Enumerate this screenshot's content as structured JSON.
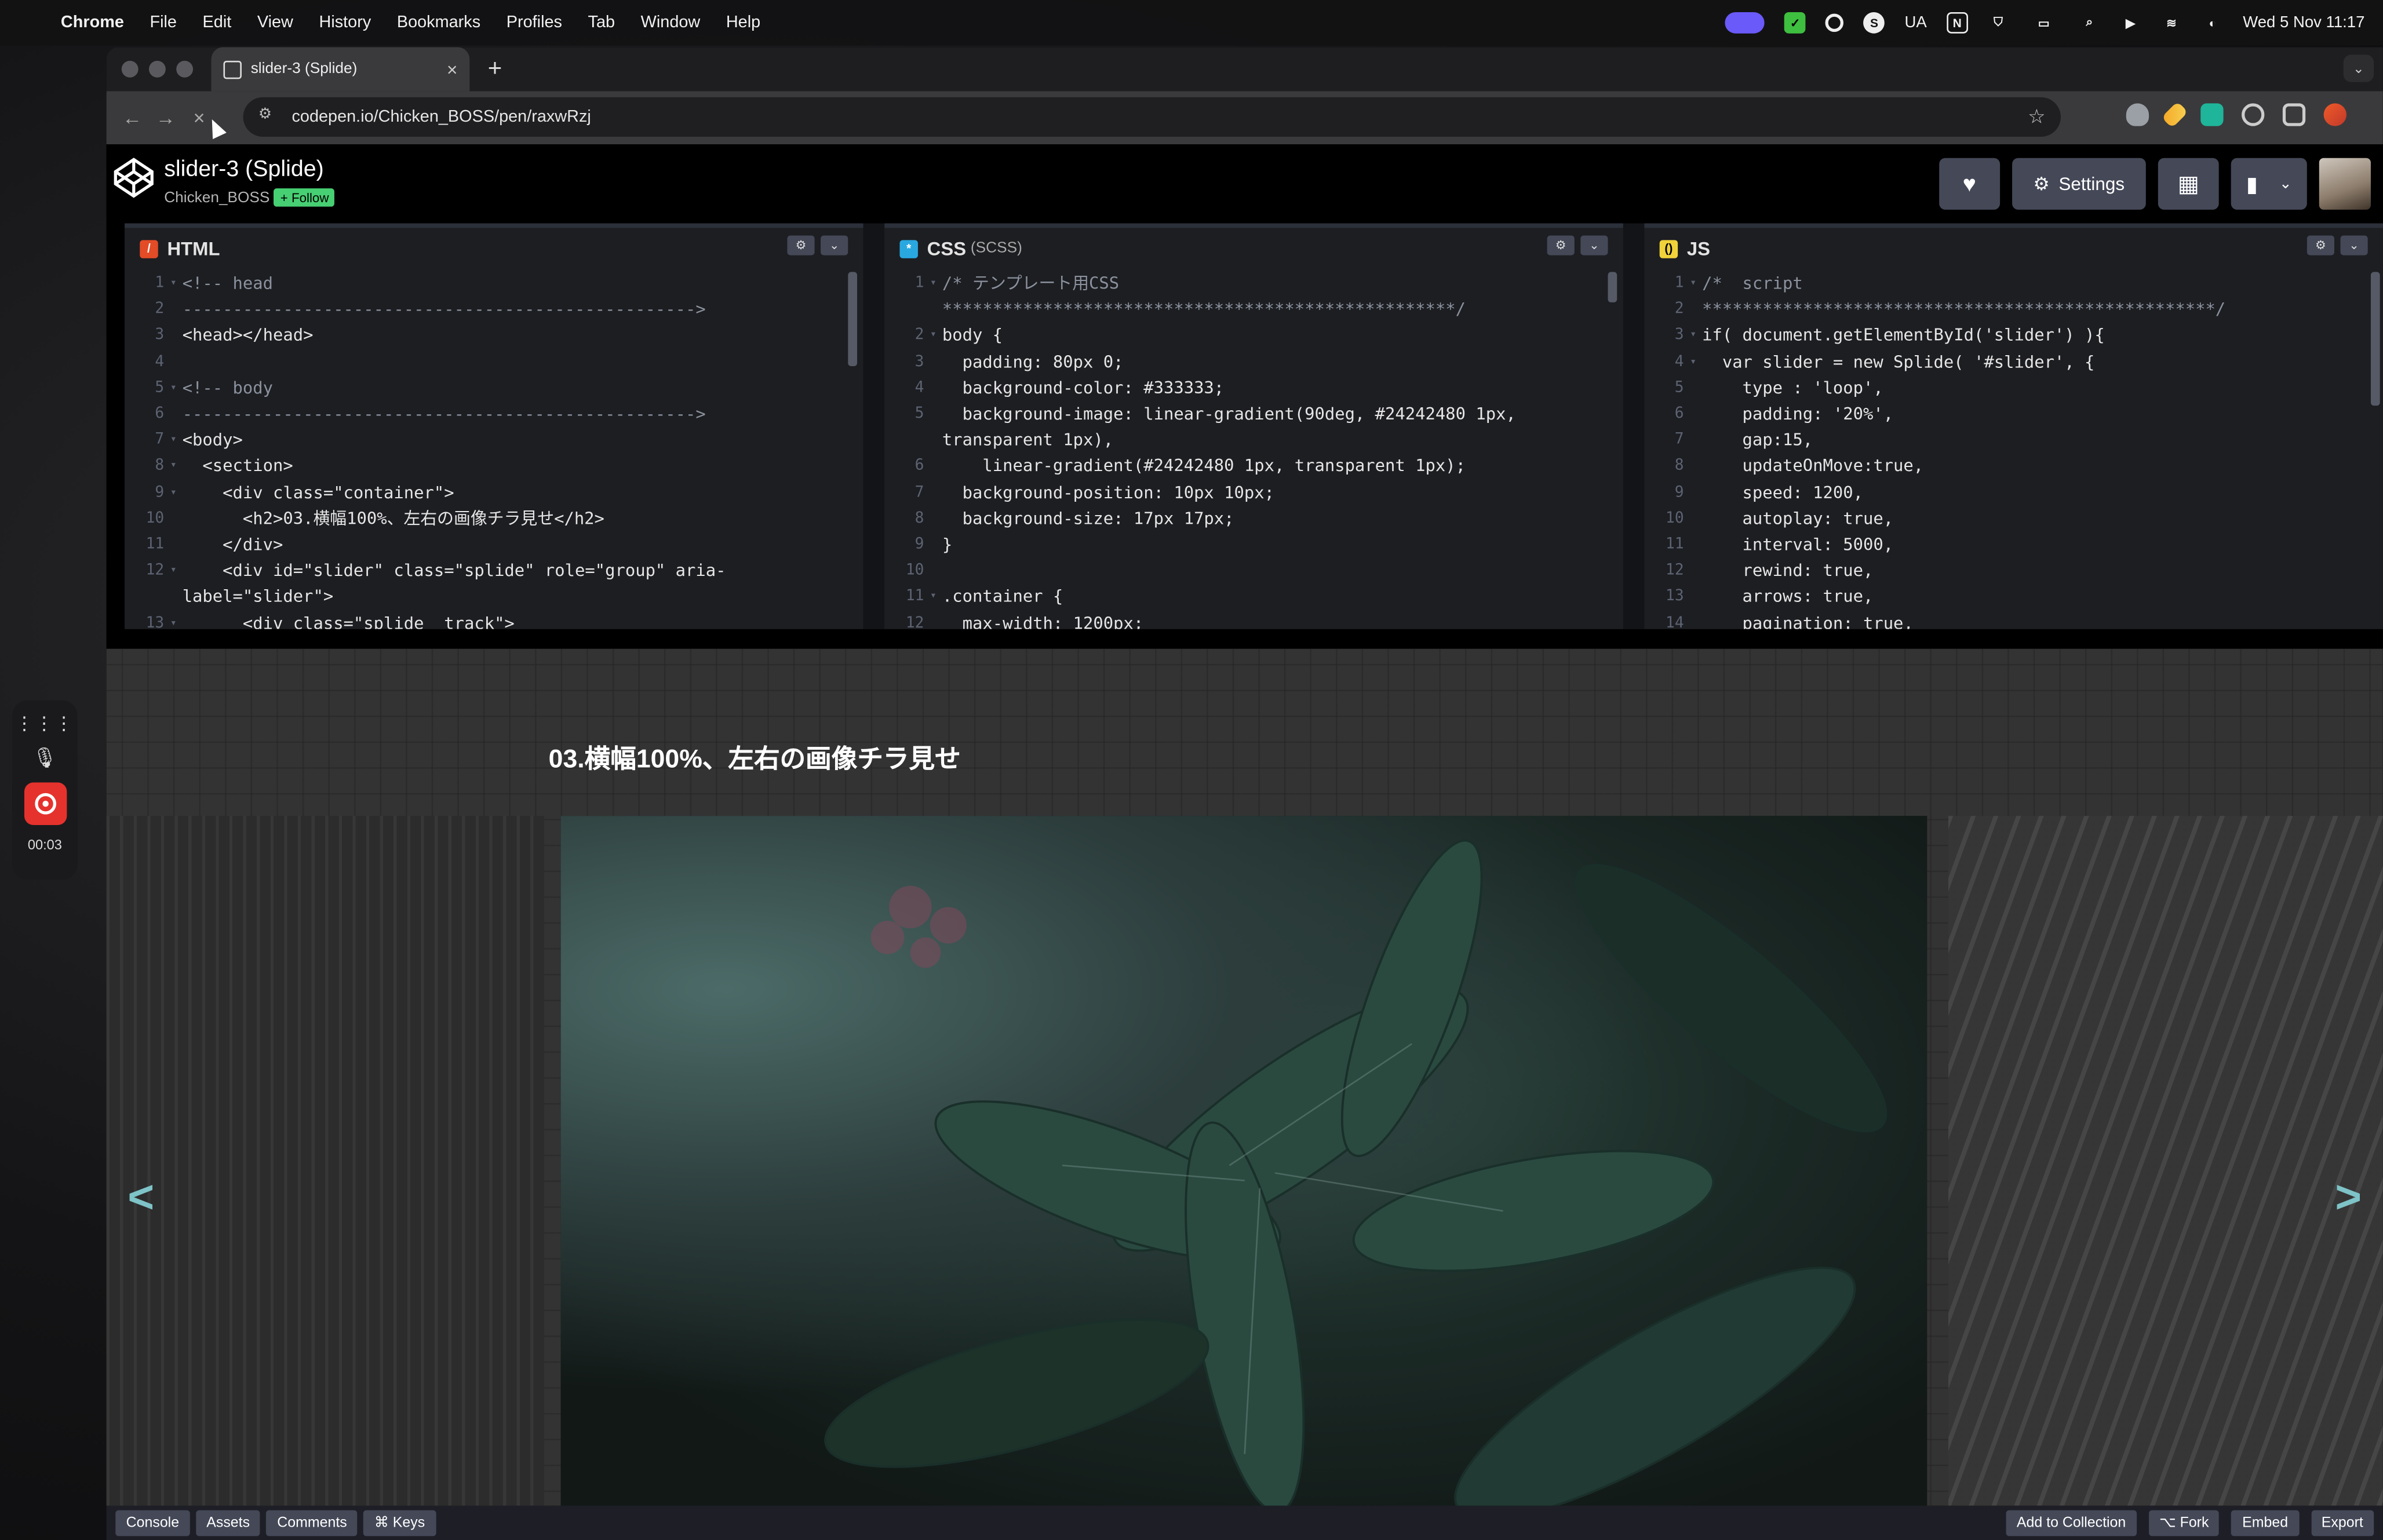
{
  "menubar": {
    "app": "Chrome",
    "items": [
      "File",
      "Edit",
      "View",
      "History",
      "Bookmarks",
      "Profiles",
      "Tab",
      "Window",
      "Help"
    ],
    "status_text": "UA",
    "datetime": "Wed 5 Nov  11:17"
  },
  "browser": {
    "tab_title": "slider-3 (Splide)",
    "url": "codepen.io/Chicken_BOSS/pen/raxwRzj"
  },
  "codepen": {
    "pen_title": "slider-3 (Splide)",
    "author": "Chicken_BOSS",
    "follow_label": "+ Follow",
    "settings_label": "Settings"
  },
  "editors": {
    "html": {
      "label": "HTML",
      "lines": [
        {
          "n": "1",
          "fold": "▾",
          "t": "<!-- head"
        },
        {
          "n": "2",
          "fold": "",
          "t": "--------------------------------------------------->"
        },
        {
          "n": "3",
          "fold": "",
          "t": "<head></head>"
        },
        {
          "n": "4",
          "fold": "",
          "t": ""
        },
        {
          "n": "5",
          "fold": "▾",
          "t": "<!-- body"
        },
        {
          "n": "6",
          "fold": "",
          "t": "--------------------------------------------------->"
        },
        {
          "n": "7",
          "fold": "▾",
          "t": "<body>"
        },
        {
          "n": "8",
          "fold": "▾",
          "t": "  <section>"
        },
        {
          "n": "9",
          "fold": "▾",
          "t": "    <div class=\"container\">"
        },
        {
          "n": "10",
          "fold": "",
          "t": "      <h2>03.横幅100%、左右の画像チラ見せ</h2>"
        },
        {
          "n": "11",
          "fold": "",
          "t": "    </div>"
        },
        {
          "n": "12",
          "fold": "▾",
          "t": "    <div id=\"slider\" class=\"splide\" role=\"group\" aria-"
        },
        {
          "n": "",
          "fold": "",
          "t": "label=\"slider\">"
        },
        {
          "n": "13",
          "fold": "▾",
          "t": "      <div class=\"splide__track\">"
        }
      ]
    },
    "css": {
      "label": "CSS",
      "sublabel": "(SCSS)",
      "lines": [
        {
          "n": "1",
          "fold": "▾",
          "t": "/* テンプレート用CSS"
        },
        {
          "n": "",
          "fold": "",
          "t": "***************************************************/"
        },
        {
          "n": "2",
          "fold": "▾",
          "t": "body {"
        },
        {
          "n": "3",
          "fold": "",
          "t": "  padding: 80px 0;"
        },
        {
          "n": "4",
          "fold": "",
          "t": "  background-color: #333333;"
        },
        {
          "n": "5",
          "fold": "",
          "t": "  background-image: linear-gradient(90deg, #24242480 1px,"
        },
        {
          "n": "",
          "fold": "",
          "t": "transparent 1px),"
        },
        {
          "n": "6",
          "fold": "",
          "t": "    linear-gradient(#24242480 1px, transparent 1px);"
        },
        {
          "n": "7",
          "fold": "",
          "t": "  background-position: 10px 10px;"
        },
        {
          "n": "8",
          "fold": "",
          "t": "  background-size: 17px 17px;"
        },
        {
          "n": "9",
          "fold": "",
          "t": "}"
        },
        {
          "n": "10",
          "fold": "",
          "t": ""
        },
        {
          "n": "11",
          "fold": "▾",
          "t": ".container {"
        },
        {
          "n": "12",
          "fold": "",
          "t": "  max-width: 1200px;"
        }
      ]
    },
    "js": {
      "label": "JS",
      "lines": [
        {
          "n": "1",
          "fold": "▾",
          "t": "/*  script"
        },
        {
          "n": "2",
          "fold": "",
          "t": "***************************************************/"
        },
        {
          "n": "3",
          "fold": "▾",
          "t": "if( document.getElementById('slider') ){"
        },
        {
          "n": "4",
          "fold": "▾",
          "t": "  var slider = new Splide( '#slider', {"
        },
        {
          "n": "5",
          "fold": "",
          "t": "    type : 'loop',"
        },
        {
          "n": "6",
          "fold": "",
          "t": "    padding: '20%',"
        },
        {
          "n": "7",
          "fold": "",
          "t": "    gap:15,"
        },
        {
          "n": "8",
          "fold": "",
          "t": "    updateOnMove:true,"
        },
        {
          "n": "9",
          "fold": "",
          "t": "    speed: 1200,"
        },
        {
          "n": "10",
          "fold": "",
          "t": "    autoplay: true,"
        },
        {
          "n": "11",
          "fold": "",
          "t": "    interval: 5000,"
        },
        {
          "n": "12",
          "fold": "",
          "t": "    rewind: true,"
        },
        {
          "n": "13",
          "fold": "",
          "t": "    arrows: true,"
        },
        {
          "n": "14",
          "fold": "",
          "t": "    pagination: true,"
        }
      ]
    }
  },
  "preview": {
    "heading": "03.横幅100%、左右の画像チラ見せ"
  },
  "footer": {
    "left": [
      "Console",
      "Assets",
      "Comments",
      "⌘ Keys"
    ],
    "right": [
      "Add to Collection",
      "⌥ Fork",
      "Embed",
      "Export"
    ]
  },
  "recorder": {
    "time": "00:03"
  },
  "colors": {
    "accent_green": "#47cf73",
    "preview_bg": "#333333",
    "arrow": "#7ec3c7",
    "record_red": "#e5322d"
  }
}
